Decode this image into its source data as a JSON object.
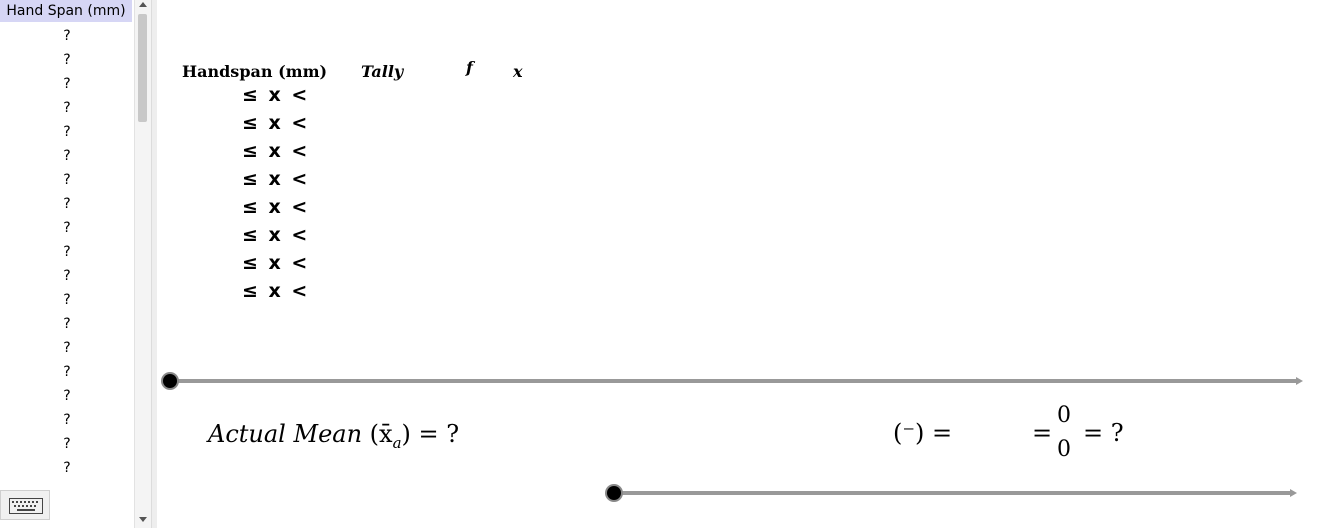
{
  "spreadsheet": {
    "header": "Hand Span (mm)",
    "cells": [
      "?",
      "?",
      "?",
      "?",
      "?",
      "?",
      "?",
      "?",
      "?",
      "?",
      "?",
      "?",
      "?",
      "?",
      "?",
      "?",
      "?",
      "?",
      "?"
    ]
  },
  "table": {
    "headers": {
      "handspan": "Handspan (mm)",
      "tally": "Tally",
      "f": "f",
      "x": "x"
    },
    "rows": [
      "≤ x <",
      "≤ x <",
      "≤ x <",
      "≤ x <",
      "≤ x <",
      "≤ x <",
      "≤ x <",
      "≤ x <"
    ]
  },
  "actual_mean": {
    "label": "Actual Mean",
    "symbol": "(x̄",
    "subscript": "a",
    "close": ")",
    "equals": "= ?"
  },
  "estimate": {
    "lhs": "(⁻) =",
    "eq1": "=",
    "numerator": "0",
    "denominator": "0",
    "result": "= ?"
  },
  "sliders": {
    "top_value": 0,
    "bottom_value": 0
  },
  "icons": {
    "keyboard": "keyboard-icon"
  }
}
